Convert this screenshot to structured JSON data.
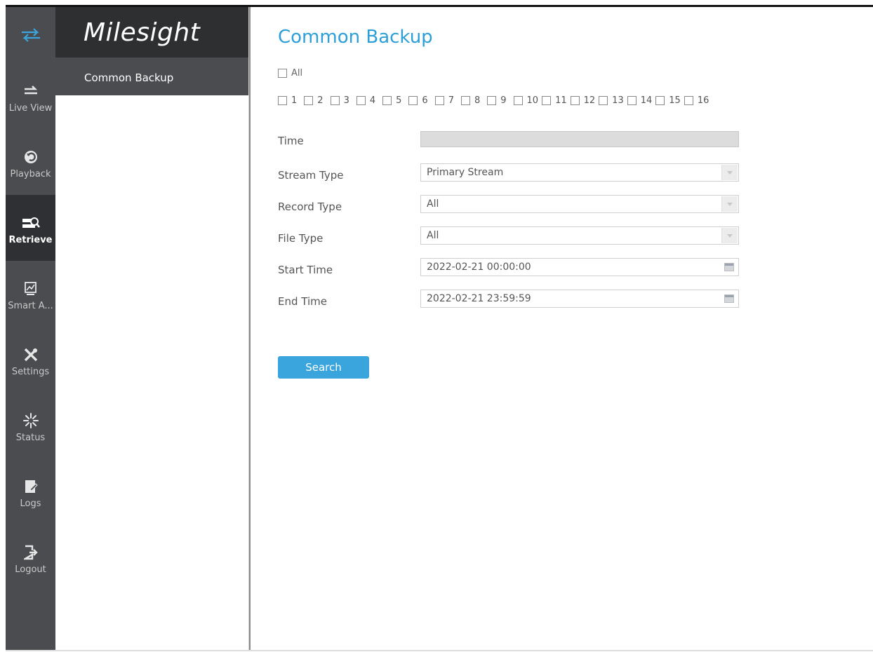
{
  "brand": "Milesight",
  "nav": [
    {
      "label": "Live View",
      "icon": "live-view-icon"
    },
    {
      "label": "Playback",
      "icon": "playback-icon"
    },
    {
      "label": "Retrieve",
      "icon": "retrieve-icon",
      "active": true
    },
    {
      "label": "Smart A...",
      "icon": "smart-analytics-icon"
    },
    {
      "label": "Settings",
      "icon": "settings-icon"
    },
    {
      "label": "Status",
      "icon": "status-icon"
    },
    {
      "label": "Logs",
      "icon": "logs-icon"
    },
    {
      "label": "Logout",
      "icon": "logout-icon"
    }
  ],
  "submenu": {
    "active_item": "Common Backup"
  },
  "page": {
    "title": "Common Backup"
  },
  "channels": {
    "all_label": "All",
    "items": [
      "1",
      "2",
      "3",
      "4",
      "5",
      "6",
      "7",
      "8",
      "9",
      "10",
      "11",
      "12",
      "13",
      "14",
      "15",
      "16"
    ]
  },
  "form": {
    "time_label": "Time",
    "time_value": "",
    "stream_type_label": "Stream Type",
    "stream_type_value": "Primary Stream",
    "record_type_label": "Record Type",
    "record_type_value": "All",
    "file_type_label": "File Type",
    "file_type_value": "All",
    "start_time_label": "Start Time",
    "start_time_value": "2022-02-21 00:00:00",
    "end_time_label": "End Time",
    "end_time_value": "2022-02-21 23:59:59"
  },
  "search_label": "Search",
  "colors": {
    "accent": "#2c9fd8",
    "button": "#3aa5dd",
    "rail": "#4a4c4f",
    "rail_active": "#2f3033"
  }
}
